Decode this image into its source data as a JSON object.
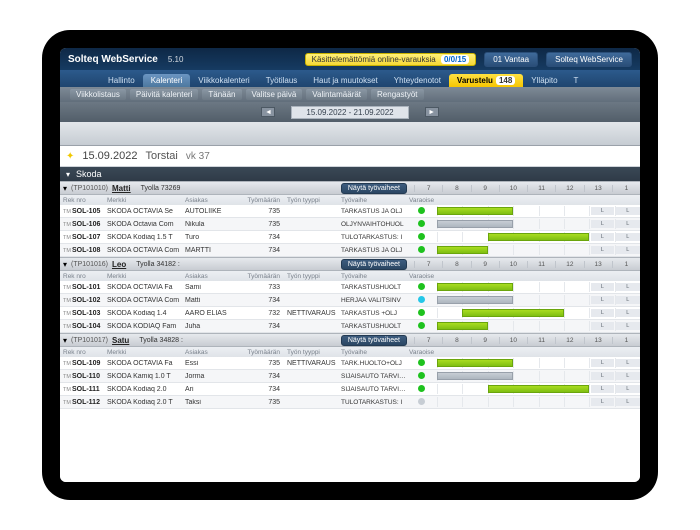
{
  "app": {
    "title": "Solteq WebService",
    "version": "5.10",
    "notice_label": "Käsittelemättömiä online-varauksia",
    "notice_badge": "0/0/15",
    "location_label": "01 Vantaa",
    "service_link": "Solteq WebService"
  },
  "nav_primary": [
    {
      "label": "Hallinto",
      "active": false
    },
    {
      "label": "Kalenteri",
      "active": true
    },
    {
      "label": "Viikkokalenteri",
      "active": false
    },
    {
      "label": "Työtilaus",
      "active": false
    },
    {
      "label": "Haut ja muutokset",
      "active": false
    },
    {
      "label": "Yhteydenotot",
      "active": false
    },
    {
      "label": "Varustelu",
      "active": false,
      "highlight": true,
      "count": "148"
    },
    {
      "label": "Ylläpito",
      "active": false
    },
    {
      "label": "T",
      "active": false
    }
  ],
  "nav_secondary": [
    {
      "label": "Viikkolistaus"
    },
    {
      "label": "Päivitä kalenteri"
    },
    {
      "label": "Tänään"
    },
    {
      "label": "Valitse päivä"
    },
    {
      "label": "Valintamäärät"
    },
    {
      "label": "Rengastyöt"
    }
  ],
  "date_nav": {
    "range": "15.09.2022 - 21.09.2022"
  },
  "day": {
    "date": "15.09.2022",
    "weekday": "Torstai",
    "week": "vk 37"
  },
  "brand_bar": {
    "label": "Skoda"
  },
  "columns": {
    "rek": "Rek nro",
    "merkki": "Merkki",
    "asiakas": "Asiakas",
    "tyom": "Työmäärän",
    "tyyppi": "Työn tyyppi",
    "tyovaihe": "Työvaihe",
    "var": "Varaoisen tila"
  },
  "hours": [
    "7",
    "8",
    "9",
    "10",
    "11",
    "12",
    "13",
    "1"
  ],
  "show_steps_label": "Näytä työvaiheet",
  "groups": [
    {
      "id": "(TP101010)",
      "name": "Matti",
      "tyolla": "Tyolla 73269",
      "rows": [
        {
          "rek": "SOL-105",
          "merkki": "SKODA OCTAVIA Se",
          "asiakas": "AUTOLIIKE",
          "tyom": "735",
          "tyyppi": "",
          "vaihe": "TARKASTUS JA ÖLJ",
          "dot": "green",
          "bars": [
            {
              "type": "green",
              "from": 0,
              "span": 3
            }
          ]
        },
        {
          "rek": "SOL-106",
          "merkki": "SKODA Octavia Com",
          "asiakas": "Nikula",
          "tyom": "735",
          "tyyppi": "",
          "vaihe": "ÖLJYNVAIHTOHUOL",
          "dot": "green",
          "bars": [
            {
              "type": "gray",
              "from": 0,
              "span": 3
            }
          ]
        },
        {
          "rek": "SOL-107",
          "merkki": "SKODA Kodiaq 1.5 T",
          "asiakas": "Turo",
          "tyom": "734",
          "tyyppi": "",
          "vaihe": "TULOTARKASTUS: I",
          "dot": "green",
          "bars": [
            {
              "type": "green",
              "from": 2,
              "span": 4
            }
          ]
        },
        {
          "rek": "SOL-108",
          "merkki": "SKODA OCTAVIA Com",
          "asiakas": "MARTTI",
          "tyom": "734",
          "tyyppi": "",
          "vaihe": "TARKASTUS JA ÖLJ",
          "dot": "green",
          "bars": [
            {
              "type": "green",
              "from": 0,
              "span": 2
            }
          ]
        }
      ]
    },
    {
      "id": "(TP101016)",
      "name": "Leo",
      "tyolla": "Tyolla 34182 :",
      "rows": [
        {
          "rek": "SOL-101",
          "merkki": "SKODA OCTAVIA Fa",
          "asiakas": "Sami",
          "tyom": "733",
          "tyyppi": "",
          "vaihe": "TARKASTUSHUOLT",
          "dot": "green",
          "bars": [
            {
              "type": "green",
              "from": 0,
              "span": 3
            }
          ]
        },
        {
          "rek": "SOL-102",
          "merkki": "SKODA OCTAVIA Com",
          "asiakas": "Matti",
          "tyom": "734",
          "tyyppi": "",
          "vaihe": "HERJAA VALITSINV",
          "dot": "cyan",
          "bars": [
            {
              "type": "gray",
              "from": 0,
              "span": 3
            }
          ]
        },
        {
          "rek": "SOL-103",
          "merkki": "SKODA Kodiaq 1.4",
          "asiakas": "AARO ELIAS",
          "tyom": "732",
          "tyyppi": "NETTIVARAUS",
          "vaihe": "TARKASTUS +ÖLJ",
          "dot": "green",
          "bars": [
            {
              "type": "green",
              "from": 1,
              "span": 4
            }
          ]
        },
        {
          "rek": "SOL-104",
          "merkki": "SKODA KODIAQ Fam",
          "asiakas": "Juha",
          "tyom": "734",
          "tyyppi": "",
          "vaihe": "TARKASTUSHUOLT",
          "dot": "green",
          "bars": [
            {
              "type": "green",
              "from": 0,
              "span": 2
            }
          ]
        }
      ]
    },
    {
      "id": "(TP101017)",
      "name": "Satu",
      "tyolla": "Tyolla 34828 :",
      "rows": [
        {
          "rek": "SOL-109",
          "merkki": "SKODA OCTAVIA Fa",
          "asiakas": "Essi",
          "tyom": "735",
          "tyyppi": "NETTIVARAUS",
          "vaihe": "TARK.HUOLTO+ÖLJ",
          "dot": "green",
          "bars": [
            {
              "type": "green",
              "from": 0,
              "span": 3
            }
          ]
        },
        {
          "rek": "SOL-110",
          "merkki": "SKODA Kamiq 1.0 T",
          "asiakas": "Jorma",
          "tyom": "734",
          "tyyppi": "",
          "vaihe": "SIJAISAUTO TARVITA/ TARKASTUSHUOLT",
          "dot": "green",
          "bars": [
            {
              "type": "gray",
              "from": 0,
              "span": 3
            }
          ]
        },
        {
          "rek": "SOL-111",
          "merkki": "SKODA Kodiaq 2.0",
          "asiakas": "Ari",
          "tyom": "734",
          "tyyppi": "",
          "vaihe": "SIJAISAUTO TARVITA/ RAITISILMASUODA",
          "dot": "green",
          "bars": [
            {
              "type": "green",
              "from": 2,
              "span": 4
            }
          ]
        },
        {
          "rek": "SOL-112",
          "merkki": "SKODA Kodiaq 2.0 T",
          "asiakas": "Taksi",
          "tyom": "735",
          "tyyppi": "",
          "vaihe": "TULOTARKASTUS: I",
          "dot": "gray",
          "bars": []
        }
      ]
    }
  ]
}
